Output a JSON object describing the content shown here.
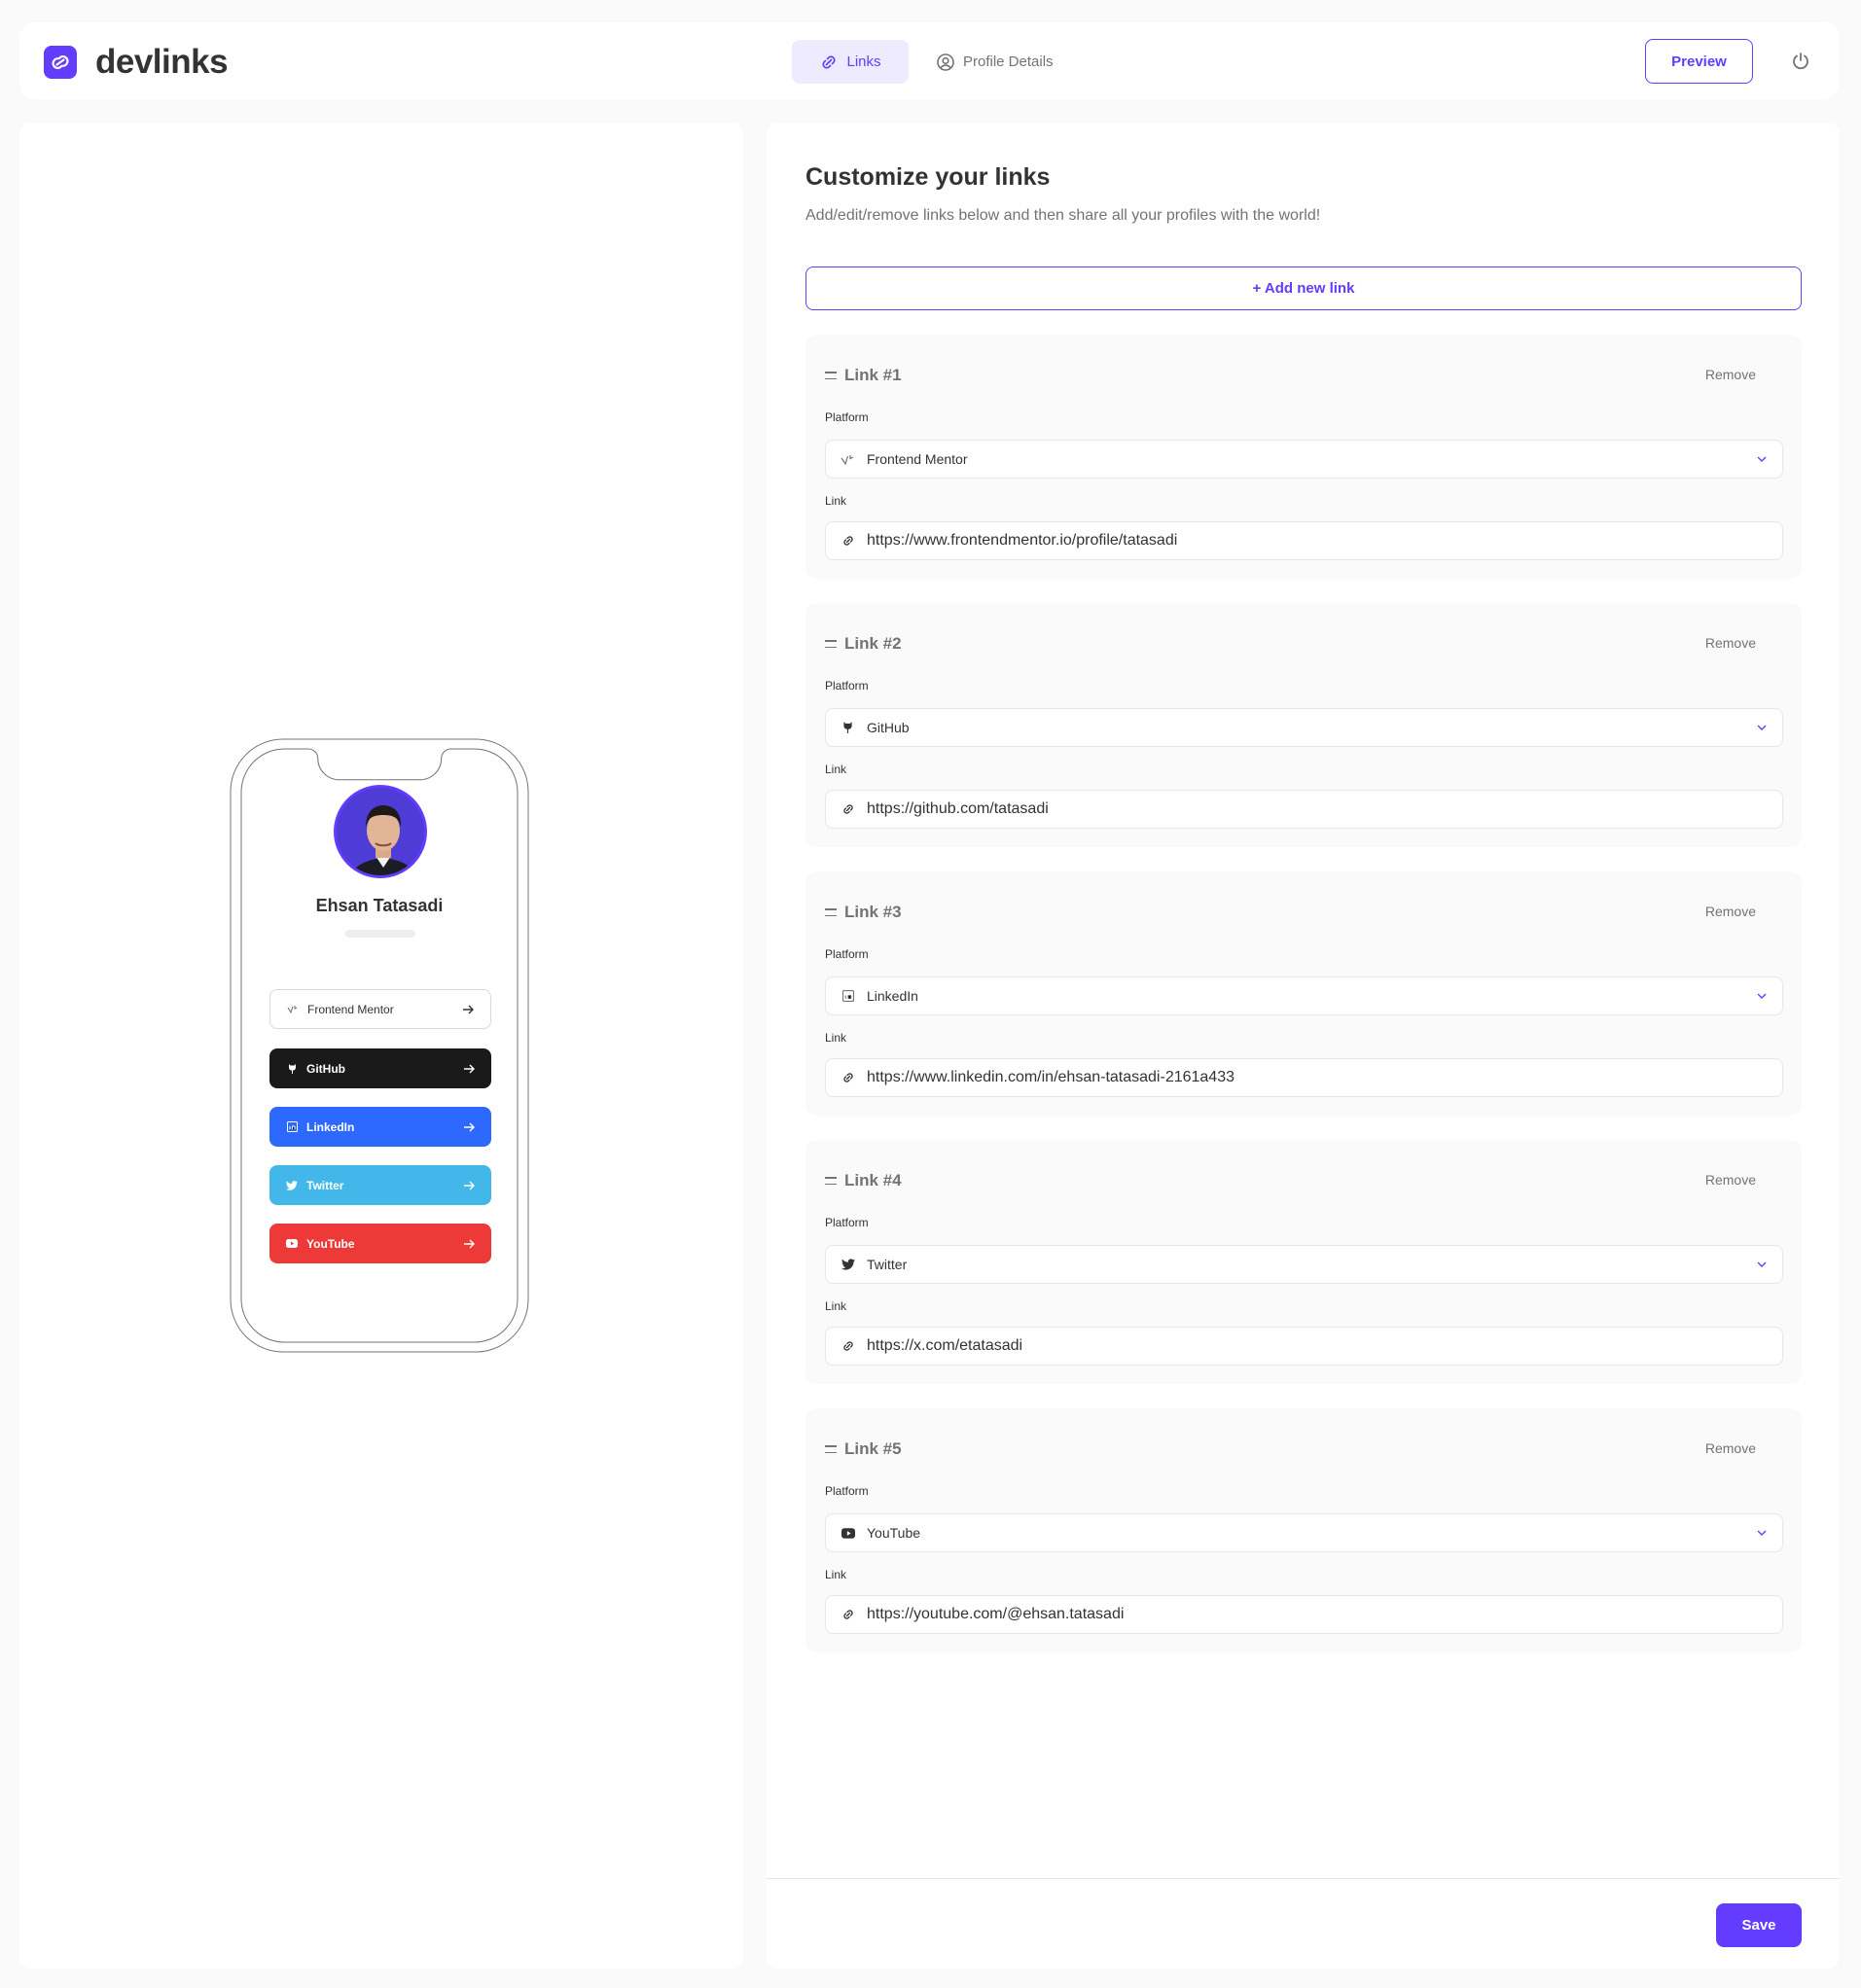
{
  "app": {
    "name": "devlinks"
  },
  "nav": {
    "tabs": [
      {
        "label": "Links",
        "active": true,
        "icon": "link-icon"
      },
      {
        "label": "Profile Details",
        "active": false,
        "icon": "user-circle-icon"
      }
    ],
    "preview_label": "Preview",
    "logout_icon": "power-icon"
  },
  "preview": {
    "name": "Ehsan Tatasadi",
    "links": [
      {
        "label": "Frontend Mentor",
        "bg": "#ffffff",
        "fg": "#333333",
        "border": "#d9d9d9",
        "icon": "frontend-mentor-icon"
      },
      {
        "label": "GitHub",
        "bg": "#1a1a1a",
        "fg": "#ffffff",
        "icon": "github-icon"
      },
      {
        "label": "LinkedIn",
        "bg": "#2d68ff",
        "fg": "#ffffff",
        "icon": "linkedin-icon"
      },
      {
        "label": "Twitter",
        "bg": "#43b7e9",
        "fg": "#ffffff",
        "icon": "twitter-icon"
      },
      {
        "label": "YouTube",
        "bg": "#ee3939",
        "fg": "#ffffff",
        "icon": "youtube-icon"
      }
    ]
  },
  "editor": {
    "title": "Customize your links",
    "subtitle": "Add/edit/remove links below and then share all your profiles with the world!",
    "add_label": "+ Add new link",
    "platform_label": "Platform",
    "link_label": "Link",
    "remove_label": "Remove",
    "links": [
      {
        "title": "Link #1",
        "platform": "Frontend Mentor",
        "url": "https://www.frontendmentor.io/profile/tatasadi",
        "icon": "frontend-mentor-icon"
      },
      {
        "title": "Link #2",
        "platform": "GitHub",
        "url": "https://github.com/tatasadi",
        "icon": "github-icon"
      },
      {
        "title": "Link #3",
        "platform": "LinkedIn",
        "url": "https://www.linkedin.com/in/ehsan-tatasadi-2161a433",
        "icon": "linkedin-icon"
      },
      {
        "title": "Link #4",
        "platform": "Twitter",
        "url": "https://x.com/etatasadi",
        "icon": "twitter-icon"
      },
      {
        "title": "Link #5",
        "platform": "YouTube",
        "url": "https://youtube.com/@ehsan.tatasadi",
        "icon": "youtube-icon"
      }
    ],
    "save_label": "Save"
  },
  "colors": {
    "accent": "#633cff",
    "accent_light": "#efebff"
  }
}
